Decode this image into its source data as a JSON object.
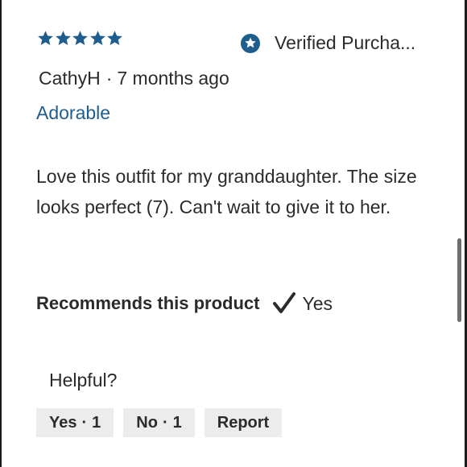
{
  "review": {
    "rating": 5,
    "rating_max": 5,
    "star_color": "#1e5d8c",
    "verified_label": "Verified Purcha...",
    "verified_icon": "verified-star-badge-icon",
    "author": "CathyH",
    "separator": "·",
    "date": "7 months ago",
    "title": "Adorable",
    "body": "Love this outfit for my granddaughter. The size looks perfect (7). Can't wait to give it to her.",
    "recommend_label": "Recommends this product",
    "recommend_icon": "checkmark-icon",
    "recommend_value": "Yes"
  },
  "feedback": {
    "helpful_label": "Helpful?",
    "yes_label": "Yes",
    "yes_count": "1",
    "no_label": "No",
    "no_count": "1",
    "report_label": "Report"
  },
  "colors": {
    "accent": "#1e5d8c",
    "text": "#2b2b2b",
    "button_bg": "#ececec"
  }
}
